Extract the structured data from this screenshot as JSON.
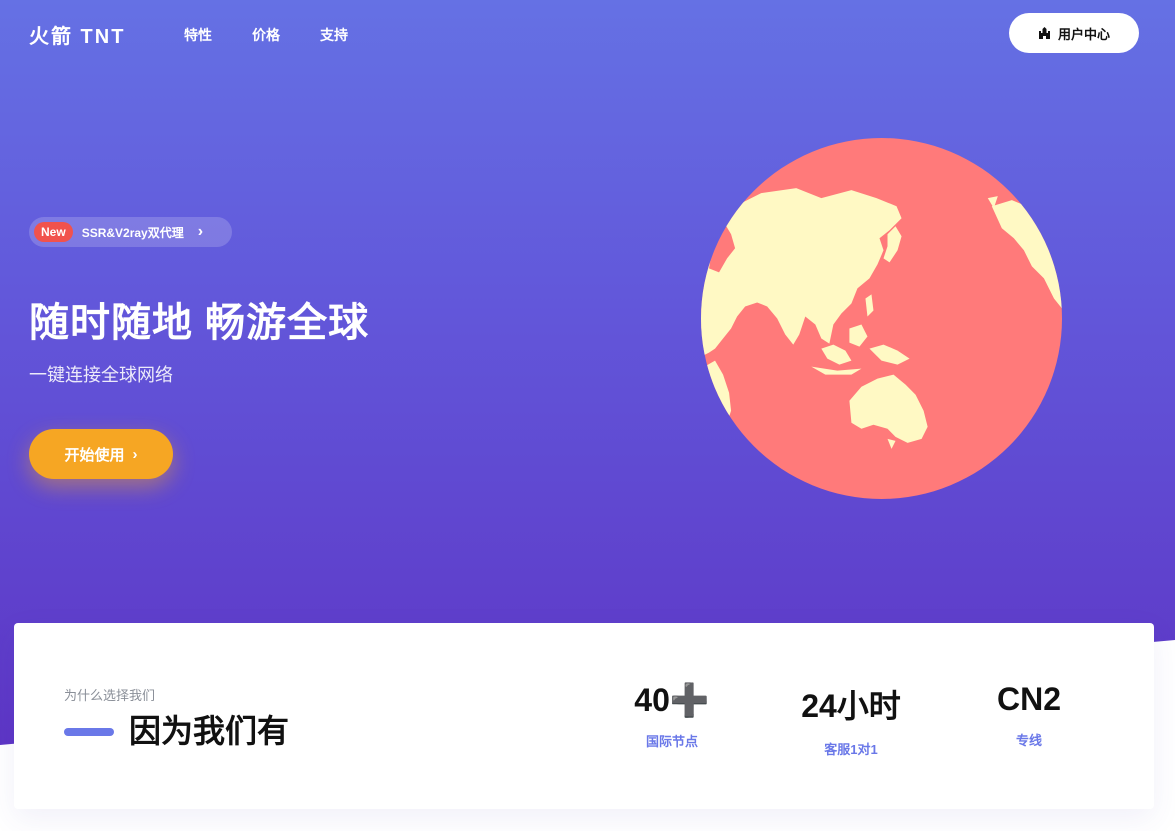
{
  "nav": {
    "brand": "火箭 TNT",
    "links": [
      "特性",
      "价格",
      "支持"
    ],
    "user_center": "用户中心",
    "user_icon": "castle-icon"
  },
  "hero": {
    "badge": "New",
    "announcement": "SSR&V2ray双代理",
    "headline": "随时随地 畅游全球",
    "subline": "一键连接全球网络",
    "cta": "开始使用",
    "colors": {
      "gradient_top": "#6571e4",
      "gradient_bottom": "#5d34c4",
      "cta": "#f6a623",
      "globe_ocean": "#ff7a7a",
      "globe_land": "#fff9c4",
      "badge": "#f1524d"
    }
  },
  "why": {
    "small": "为什么选择我们",
    "title": "因为我们有",
    "accent": "#6a78e8"
  },
  "stats": [
    {
      "value": "40➕",
      "label": "国际节点"
    },
    {
      "value": "24小时",
      "label": "客服1对1"
    },
    {
      "value": "CN2",
      "label": "专线"
    }
  ]
}
